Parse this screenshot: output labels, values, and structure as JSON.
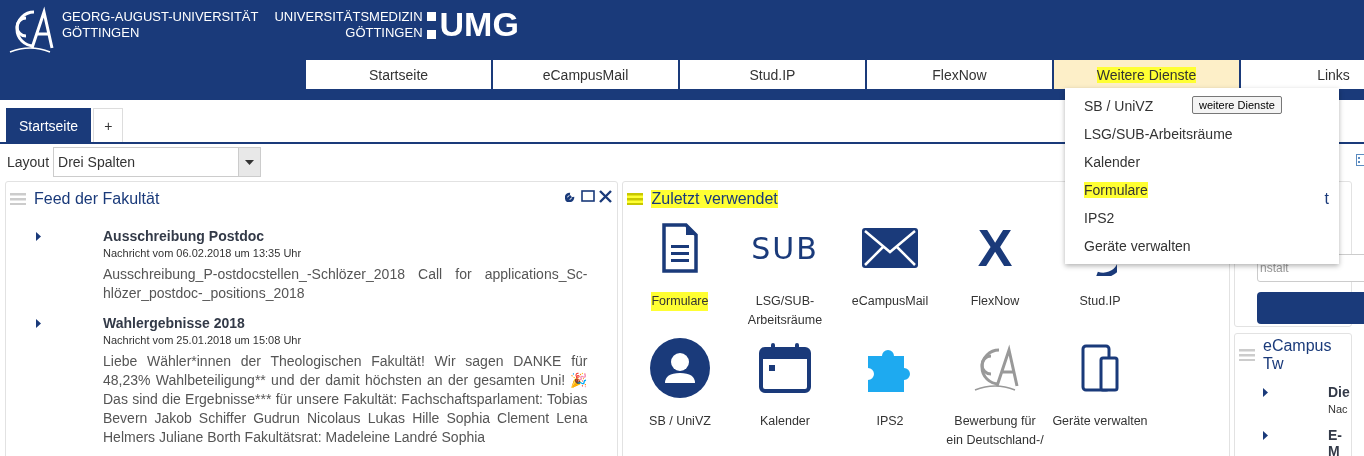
{
  "header": {
    "university": [
      "GEORG-AUGUST-UNIVERSITÄT",
      "GÖTTINGEN"
    ],
    "medicine": [
      "UNIVERSITÄTSMEDIZIN",
      "GÖTTINGEN"
    ],
    "medicine_mark": "UMG"
  },
  "nav": [
    {
      "label": "Startseite",
      "selected": false,
      "highlighted": false
    },
    {
      "label": "eCampusMail",
      "selected": false,
      "highlighted": false
    },
    {
      "label": "Stud.IP",
      "selected": false,
      "highlighted": false
    },
    {
      "label": "FlexNow",
      "selected": false,
      "highlighted": false
    },
    {
      "label": "Weitere Dienste",
      "selected": true,
      "highlighted": true
    },
    {
      "label": "Links",
      "selected": false,
      "highlighted": false
    }
  ],
  "dropdown": {
    "items": [
      {
        "label": "SB / UniVZ",
        "highlighted": false
      },
      {
        "label": "LSG/SUB-Arbeitsräume",
        "highlighted": false
      },
      {
        "label": "Kalender",
        "highlighted": false
      },
      {
        "label": "Formulare",
        "highlighted": true
      },
      {
        "label": "IPS2",
        "highlighted": false
      },
      {
        "label": "Geräte verwalten",
        "highlighted": false
      }
    ],
    "tooltip": "weitere Dienste"
  },
  "page_tabs": [
    {
      "label": "Startseite",
      "selected": true
    },
    {
      "label": "+",
      "selected": false
    }
  ],
  "layout": {
    "label": "Layout",
    "value": "Drei Spalten"
  },
  "feed": {
    "title": "Feed der Fakultät",
    "items": [
      {
        "title": "Ausschreibung Postdoc",
        "date": "Nachricht vom 06.02.2018 um 13:35 Uhr",
        "body": "Ausschreibung_P-ostdocstellen_-Schlözer_2018 Call for applications_Sc-hlözer_postdoc-_positions_2018"
      },
      {
        "title": "Wahlergebnisse 2018",
        "date": "Nachricht vom 25.01.2018 um 15:08 Uhr",
        "body": "Liebe Wähler*innen der Theologischen Fakultät! Wir sagen DANKE für 48,23% Wahlbeteiligung** und der damit höchsten an der gesamten Uni! 🎉 Das sind die Ergebnisse*** für unsere Fakultät: Fachschaftsparlament: Tobias Bevern Jakob Schiffer Gudrun Nicolaus Lukas Hille Sophia Clement Lena Helmers Juliane Borth Fakultätsrat: Madeleine Landré Sophia"
      }
    ]
  },
  "recent": {
    "title": "Zuletzt verwendet",
    "highlighted": true,
    "apps": [
      {
        "kind": "document",
        "label": "Formulare",
        "highlighted": true
      },
      {
        "kind": "sub",
        "label": "LSG/SUB-Arbeitsräume",
        "logo_text": "SUB",
        "highlighted": false
      },
      {
        "kind": "mail",
        "label": "eCampusMail",
        "highlighted": false
      },
      {
        "kind": "x",
        "label": "FlexNow",
        "logo_text": "X",
        "highlighted": false
      },
      {
        "kind": "studip",
        "label": "Stud.IP",
        "highlighted": false
      },
      {
        "kind": "person",
        "label": "SB / UniVZ",
        "highlighted": false
      },
      {
        "kind": "calendar",
        "label": "Kalender",
        "highlighted": false
      },
      {
        "kind": "puzzle",
        "label": "IPS2",
        "highlighted": false
      },
      {
        "kind": "seal",
        "label": "Bewerbung für ein Deutschland-/",
        "highlighted": false
      },
      {
        "kind": "devices",
        "label": "Geräte verwalten",
        "highlighted": false
      }
    ]
  },
  "right": {
    "search_panel": {
      "title": "t",
      "placeholder": "nstalt"
    },
    "twitter_panel": {
      "title": "eCampus Tw",
      "items": [
        {
          "title": "Die",
          "date": "Nac"
        },
        {
          "title": "E-M"
        }
      ]
    }
  }
}
